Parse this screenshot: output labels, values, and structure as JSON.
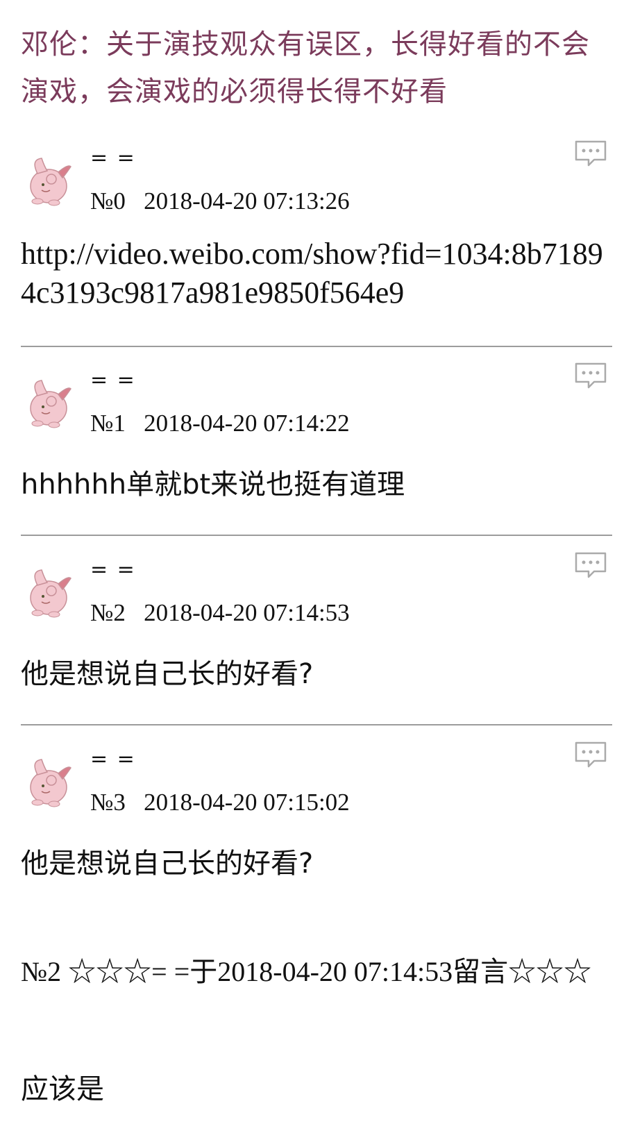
{
  "header": {
    "title": "邓伦：关于演技观众有误区，长得好看的不会演戏，会演戏的必须得长得不好看"
  },
  "posts": [
    {
      "author": "= =",
      "floor": "№0",
      "time": "2018-04-20 07:13:26",
      "content": "http://video.weibo.com/show?fid=1034:8b71894c3193c9817a981e9850f564e9"
    },
    {
      "author": "= =",
      "floor": "№1",
      "time": "2018-04-20 07:14:22",
      "content": "hhhhhh单就bt来说也挺有道理"
    },
    {
      "author": "= =",
      "floor": "№2",
      "time": "2018-04-20 07:14:53",
      "content": "他是想说自己长的好看?"
    },
    {
      "author": "= =",
      "floor": "№3",
      "time": "2018-04-20 07:15:02",
      "content": "他是想说自己长的好看?",
      "quote": "№2 ☆☆☆= =于2018-04-20 07:14:53留言☆☆☆",
      "reply": "应该是"
    }
  ],
  "colors": {
    "title": "#7b3b5b",
    "divider": "#9c9c9c",
    "icon": "#aaaaaa"
  },
  "icons": {
    "avatar": "pink-pokemon-avatar-icon",
    "reply": "speech-bubble-reply-icon"
  }
}
